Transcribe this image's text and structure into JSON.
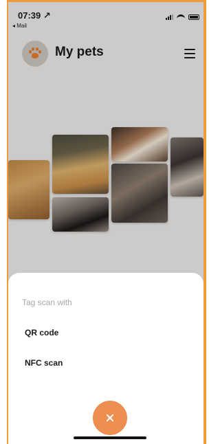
{
  "status_bar": {
    "time": "07:39 ↗",
    "back_app": "◂ Mail"
  },
  "header": {
    "title": "My pets",
    "logo_icon": "paw-icon",
    "menu_icon": "hamburger-menu-icon"
  },
  "collage": {
    "photos": [
      "golden-dog-photo",
      "puppy-photo",
      "kittens-photo",
      "two-puppies-photo",
      "cat-photo",
      "kitten-photo"
    ]
  },
  "sheet": {
    "title": "Tag scan with",
    "options": [
      {
        "label": "QR code"
      },
      {
        "label": "NFC scan"
      }
    ],
    "close_icon": "close-icon"
  },
  "colors": {
    "accent": "#ee8d50",
    "paw": "#e07a2a",
    "frame": "#f09a3a"
  }
}
